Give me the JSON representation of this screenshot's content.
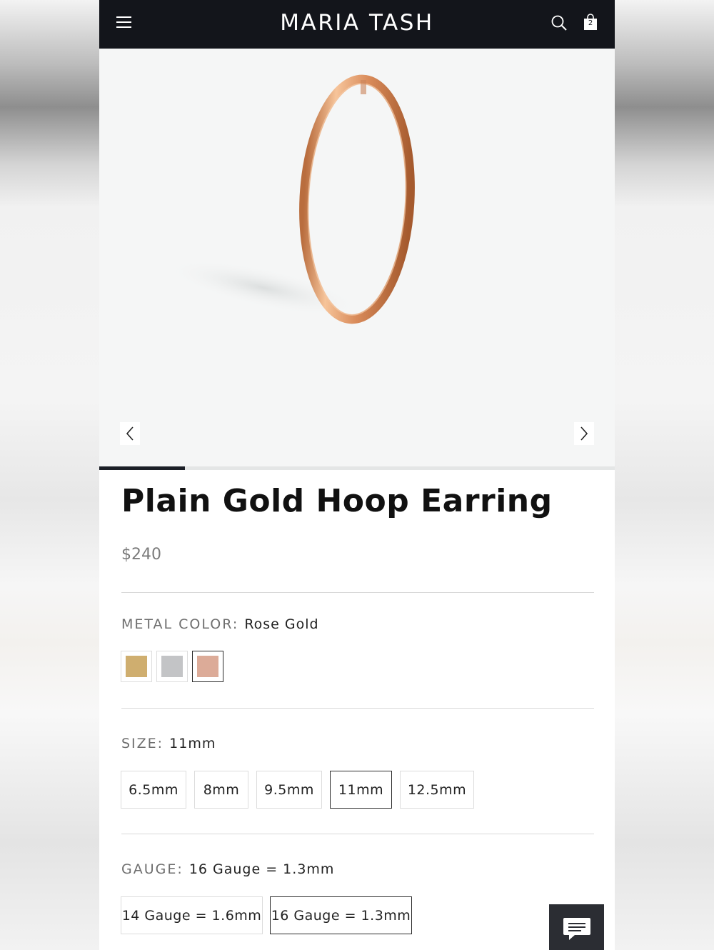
{
  "header": {
    "brand": "MARIA TASH",
    "cart_count": "2",
    "menu_icon": "hamburger-menu-icon",
    "search_icon": "search-icon",
    "cart_icon": "shopping-bag-icon"
  },
  "gallery": {
    "prev_icon": "chevron-left-icon",
    "next_icon": "chevron-right-icon",
    "image": "rose-gold-hoop-earring",
    "progress": 0.1667
  },
  "product": {
    "title": "Plain Gold Hoop Earring",
    "price": "$240"
  },
  "metal_color": {
    "label": "METAL COLOR:",
    "value": "Rose Gold",
    "swatches": [
      {
        "name": "Yellow Gold",
        "color": "#cfae6f",
        "selected": false
      },
      {
        "name": "White Gold",
        "color": "#c3c4c6",
        "selected": false
      },
      {
        "name": "Rose Gold",
        "color": "#dcab98",
        "selected": true
      }
    ]
  },
  "size": {
    "label": "SIZE:",
    "value": "11mm",
    "options": [
      "6.5mm",
      "8mm",
      "9.5mm",
      "11mm",
      "12.5mm"
    ],
    "selected_index": 3
  },
  "gauge": {
    "label": "GAUGE:",
    "value": "16 Gauge = 1.3mm",
    "options": [
      "14 Gauge = 1.6mm",
      "16 Gauge = 1.3mm"
    ],
    "selected_index": 1
  },
  "chat": {
    "icon": "chat-bubble-icon"
  }
}
